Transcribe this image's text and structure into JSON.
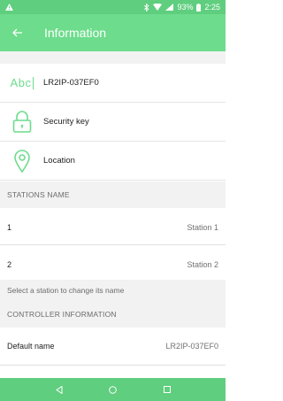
{
  "status_bar": {
    "battery": "93%",
    "time": "2:25"
  },
  "app_bar": {
    "title": "Information"
  },
  "device": {
    "name": "LR2IP-037EF0",
    "security_label": "Security key",
    "location_label": "Location"
  },
  "stations_section": {
    "header": "STATIONS NAME",
    "stations": [
      {
        "number": "1",
        "name": "Station 1"
      },
      {
        "number": "2",
        "name": "Station 2"
      }
    ],
    "hint": "Select a station to change its name"
  },
  "controller_section": {
    "header": "CONTROLLER INFORMATION",
    "default_name_label": "Default name",
    "default_name_value": "LR2IP-037EF0"
  },
  "colors": {
    "accent": "#6ddc8c",
    "status_bar": "#5fce7e"
  },
  "icons": {
    "back": "arrow-left-icon",
    "text_field": "abc-icon",
    "lock": "lock-icon",
    "location": "location-pin-icon"
  }
}
